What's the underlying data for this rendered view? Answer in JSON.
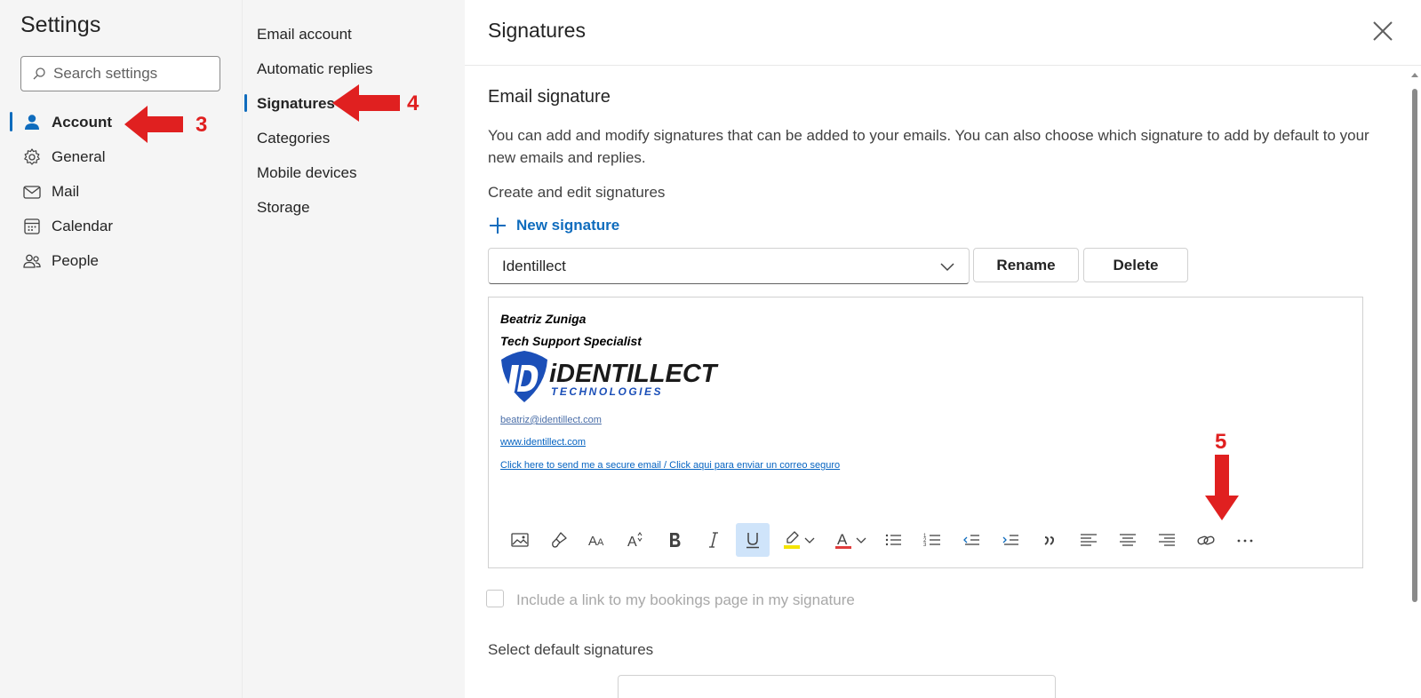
{
  "settings": {
    "title": "Settings",
    "search_placeholder": "Search settings"
  },
  "nav": {
    "items": [
      {
        "label": "Account",
        "icon": "person-icon",
        "active": true
      },
      {
        "label": "General",
        "icon": "gear-icon"
      },
      {
        "label": "Mail",
        "icon": "mail-icon"
      },
      {
        "label": "Calendar",
        "icon": "calendar-icon"
      },
      {
        "label": "People",
        "icon": "people-icon"
      }
    ]
  },
  "subnav": {
    "items": [
      {
        "label": "Email account"
      },
      {
        "label": "Automatic replies"
      },
      {
        "label": "Signatures",
        "active": true
      },
      {
        "label": "Categories"
      },
      {
        "label": "Mobile devices"
      },
      {
        "label": "Storage"
      }
    ]
  },
  "panel": {
    "title": "Signatures",
    "section_title": "Email signature",
    "description": "You can add and modify signatures that can be added to your emails. You can also choose which signature to add by default to your new emails and replies.",
    "create_label": "Create and edit signatures",
    "new_signature": "New signature",
    "selected_signature": "Identillect",
    "rename": "Rename",
    "delete": "Delete",
    "include_bookings": "Include a link to my bookings page in my signature",
    "select_default": "Select default signatures"
  },
  "signature": {
    "name": "Beatriz Zuniga",
    "role": "Tech Support Specialist",
    "logo_main": "iDENTILLECT",
    "logo_sub": "TECHNOLOGIES",
    "email": "beatriz@identillect.com",
    "website": "www.identillect.com",
    "secure_link": "Click here to send me a secure email / Click aqui para enviar un correo seguro"
  },
  "annotations": {
    "a3": "3",
    "a4": "4",
    "a5": "5"
  },
  "colors": {
    "accent": "#0f6cbd",
    "annotation": "#e02020",
    "logo_blue": "#1b4fb8"
  }
}
